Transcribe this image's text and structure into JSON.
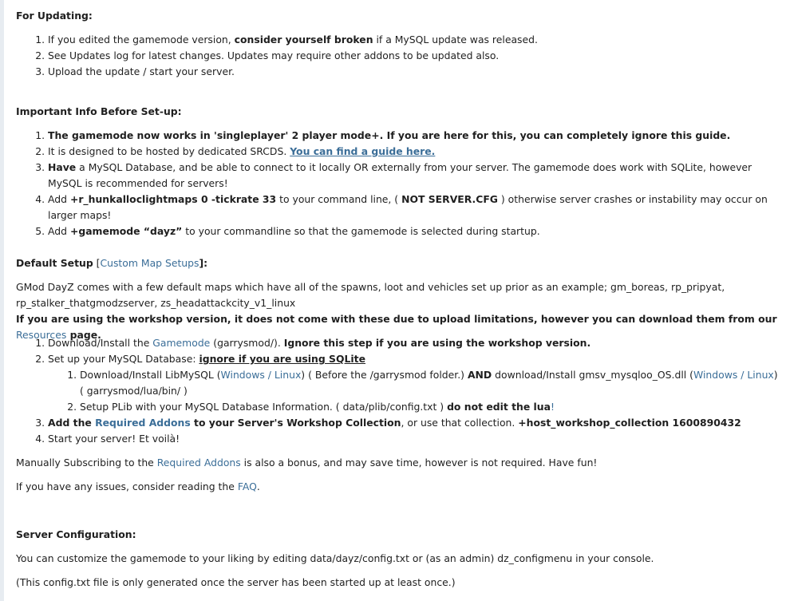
{
  "updating": {
    "heading": "For Updating:",
    "items": [
      {
        "a": "If you edited the gamemode version, ",
        "b": "consider yourself broken",
        "c": " if a MySQL update was released."
      },
      {
        "a": "See Updates log for latest changes. Updates may require other addons to be updated also."
      },
      {
        "a": "Upload the update / start your server."
      }
    ]
  },
  "important": {
    "heading": "Important Info Before Set-up:",
    "item1": "The gamemode now works in 'singleplayer' 2 player mode+. If you are here for this, you can completely ignore this guide.",
    "item2_a": "It is designed to be hosted by dedicated SRCDS. ",
    "item2_link": "You can find a guide here.",
    "item3_b": "Have",
    "item3_a": " a MySQL Database, and be able to connect to it locally OR externally from your server. The gamemode does work with SQLite, however MySQL is recommended for servers!",
    "item4_a": "Add ",
    "item4_b": "+r_hunkalloclightmaps 0 -tickrate 33",
    "item4_c": " to your command line, ( ",
    "item4_d": "NOT SERVER.CFG",
    "item4_e": " ) otherwise server crashes or instability may occur on larger maps!",
    "item5_a": "Add ",
    "item5_b": "+gamemode “dayz”",
    "item5_c": " to your commandline so that the gamemode is selected during startup."
  },
  "default_setup": {
    "heading": "Default Setup",
    "bracket_open": " [",
    "custom_link": "Custom Map Setups",
    "bracket_close": "]:",
    "intro": "GMod DayZ comes with a few default maps which have all of the spawns, loot and vehicles set up prior as an example; gm_boreas, rp_pripyat, rp_stalker_thatgmodzserver, zs_headattackcity_v1_linux",
    "workshop_note_a": "If you are using the workshop version, it does not come with these due to upload limitations, however you can download them from our ",
    "resources_link": "Resources",
    "workshop_note_b": " page.",
    "step1_a": "Download/Install the ",
    "step1_link": "Gamemode",
    "step1_b": " (garrysmod/). ",
    "step1_c": "Ignore this step if you are using the workshop version.",
    "step2_a": "Set up your MySQL Database: ",
    "step2_b": "ignore if you are using SQLite",
    "sub1_a": "Download/Install LibMySQL (",
    "sub1_win": "Windows",
    "sub1_sep": " / ",
    "sub1_lin": "Linux",
    "sub1_b": ") ( Before the /garrysmod folder.) ",
    "sub1_and": "AND",
    "sub1_c": " download/Install gmsv_mysqloo_OS.dll (",
    "sub1_win2": "Windows",
    "sub1_sep2": " / ",
    "sub1_lin2": "Linux",
    "sub1_d": ") ( garrysmod/lua/bin/ )",
    "sub2_a": "Setup PLib with your MySQL Database Information. ( data/plib/config.txt ) ",
    "sub2_b": "do not edit the lua",
    "sub2_c": "!",
    "step3_a": "Add the ",
    "step3_link": "Required Addons",
    "step3_b": " to your Server's Workshop Collection",
    "step3_c": ", or use that collection. ",
    "step3_d": "+host_workshop_collection 1600890432",
    "step4": "Start your server! Et voilà!",
    "manual_a": "Manually Subscribing to the ",
    "manual_link": "Required Addons",
    "manual_b": " is also a bonus, and may save time, however is not required. Have fun!",
    "issues_a": "If you have any issues, consider reading the ",
    "issues_link": "FAQ",
    "issues_b": "."
  },
  "server_config": {
    "heading": "Server Configuration:",
    "line1": "You can customize the gamemode to your liking by editing data/dayz/config.txt or (as an admin) dz_configmenu in your console.",
    "line2": "(This config.txt file is only generated once the server has been started up at least once.)"
  }
}
